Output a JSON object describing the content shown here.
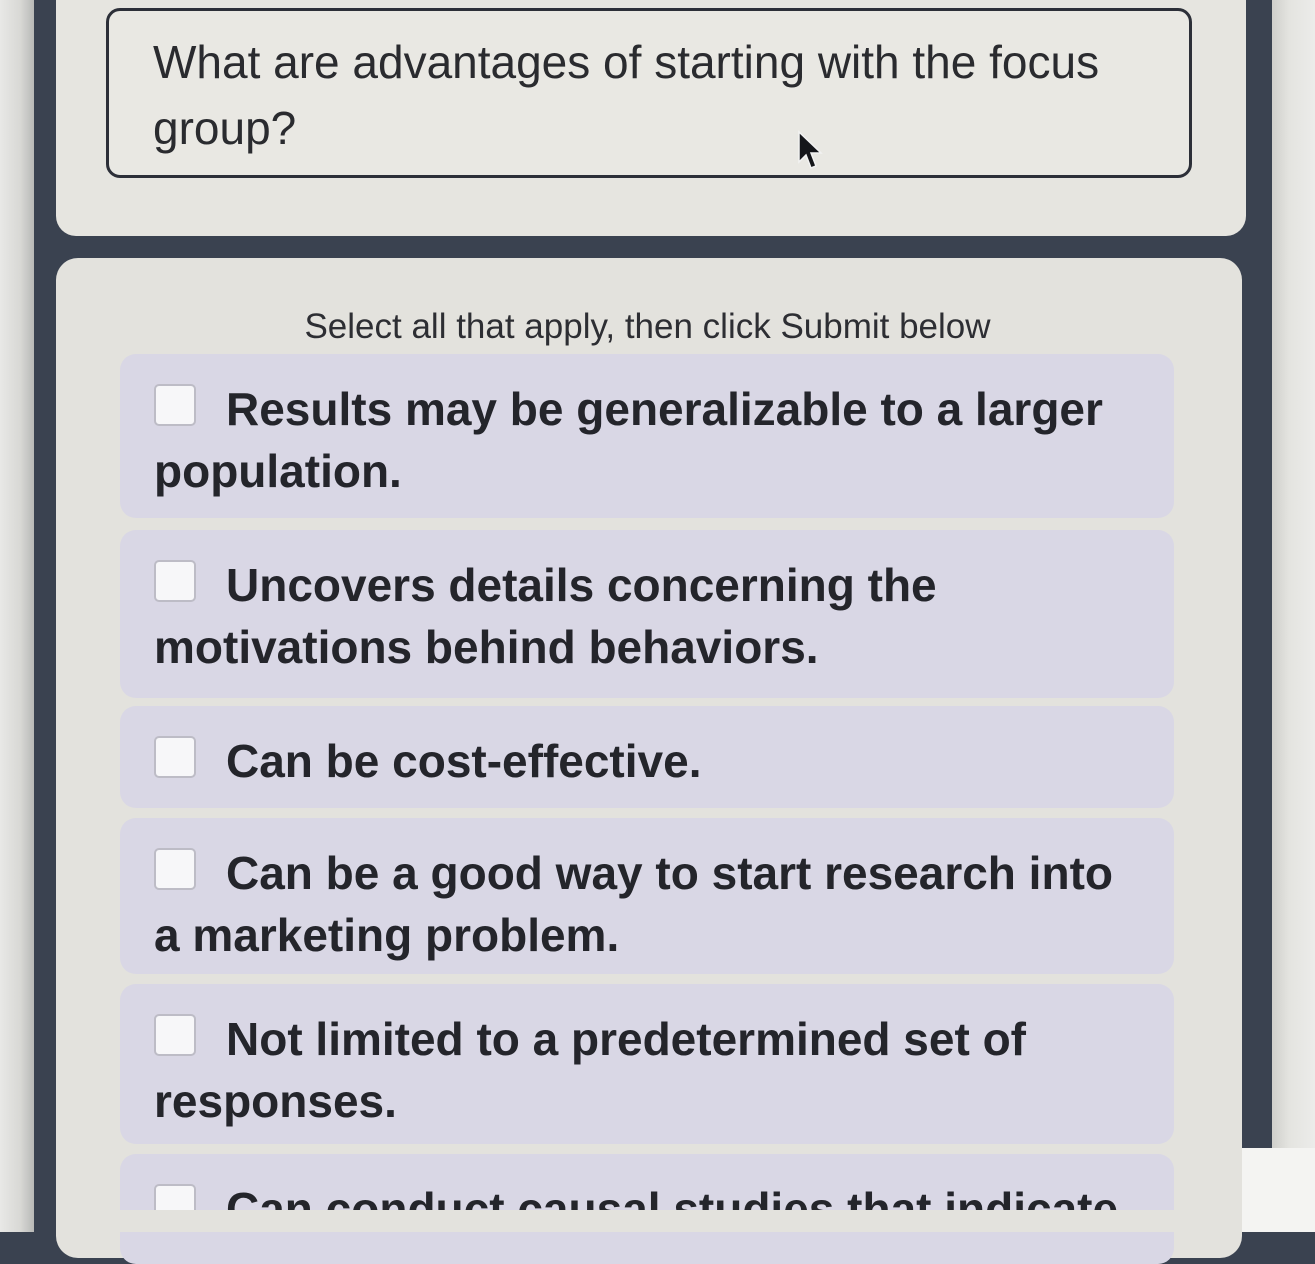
{
  "question": {
    "text": "What are advantages of starting with the focus group?"
  },
  "instructions": "Select all that apply, then click Submit below",
  "options": [
    {
      "label": "Results may be generalizable to a larger population.",
      "checked": false
    },
    {
      "label": "Uncovers details concerning the motivations behind behaviors.",
      "checked": false
    },
    {
      "label": "Can be cost-effective.",
      "checked": false
    },
    {
      "label": "Can be a good way to start research into a marketing problem.",
      "checked": false
    },
    {
      "label": "Not limited to a predetermined set of responses.",
      "checked": false
    },
    {
      "label": "Can conduct causal studies that indicate",
      "checked": false
    }
  ],
  "icons": {
    "cursor": "mouse-pointer-icon"
  },
  "colors": {
    "option_background": "#d9d7e5",
    "card_background": "#e3e2dd",
    "frame": "#3a4250",
    "question_border": "#2c2f38"
  }
}
